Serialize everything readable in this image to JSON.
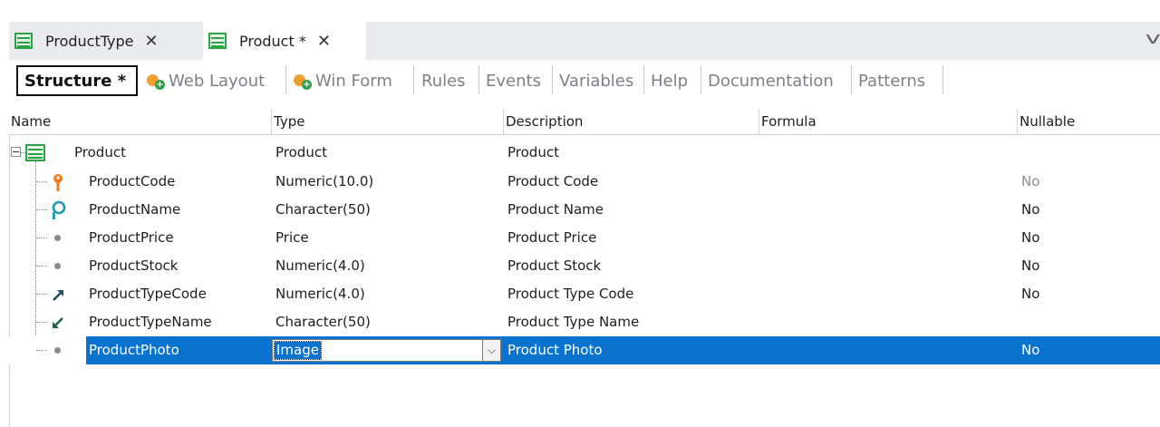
{
  "doc_tabs": [
    {
      "label": "ProductType",
      "close": "✕"
    },
    {
      "label": "Product *",
      "close": "✕"
    }
  ],
  "sub_tabs": {
    "structure": "Structure *",
    "web_layout": "Web Layout",
    "win_form": "Win Form",
    "rules": "Rules",
    "events": "Events",
    "variables": "Variables",
    "help": "Help",
    "documentation": "Documentation",
    "patterns": "Patterns"
  },
  "grid": {
    "columns": {
      "name": "Name",
      "type": "Type",
      "description": "Description",
      "formula": "Formula",
      "nullable": "Nullable"
    },
    "root": {
      "name": "Product",
      "type": "Product",
      "description": "Product"
    },
    "rows": [
      {
        "name": "ProductCode",
        "type": "Numeric(10.0)",
        "description": "Product Code",
        "nullable": "No",
        "icon": "primary-key-icon"
      },
      {
        "name": "ProductName",
        "type": "Character(50)",
        "description": "Product Name",
        "nullable": "No",
        "icon": "candidate-key-icon"
      },
      {
        "name": "ProductPrice",
        "type": "Price",
        "description": "Product Price",
        "nullable": "No",
        "icon": "attribute-dot-icon"
      },
      {
        "name": "ProductStock",
        "type": "Numeric(4.0)",
        "description": "Product Stock",
        "nullable": "No",
        "icon": "attribute-dot-icon"
      },
      {
        "name": "ProductTypeCode",
        "type": "Numeric(4.0)",
        "description": "Product Type Code",
        "nullable": "No",
        "icon": "foreign-key-icon"
      },
      {
        "name": "ProductTypeName",
        "type": "Character(50)",
        "description": "Product Type Name",
        "nullable": "",
        "icon": "inferred-attribute-icon"
      },
      {
        "name": "ProductPhoto",
        "type": "Image",
        "description": "Product Photo",
        "nullable": "No",
        "icon": "attribute-dot-icon"
      }
    ]
  },
  "colors": {
    "selection": "#0a73d0",
    "tab_strip": "#e9ebee",
    "key_orange": "#f07d1a",
    "key_teal": "#1b9bb0",
    "fk_dark": "#1e4f5e",
    "structure_green": "#2aa246"
  }
}
